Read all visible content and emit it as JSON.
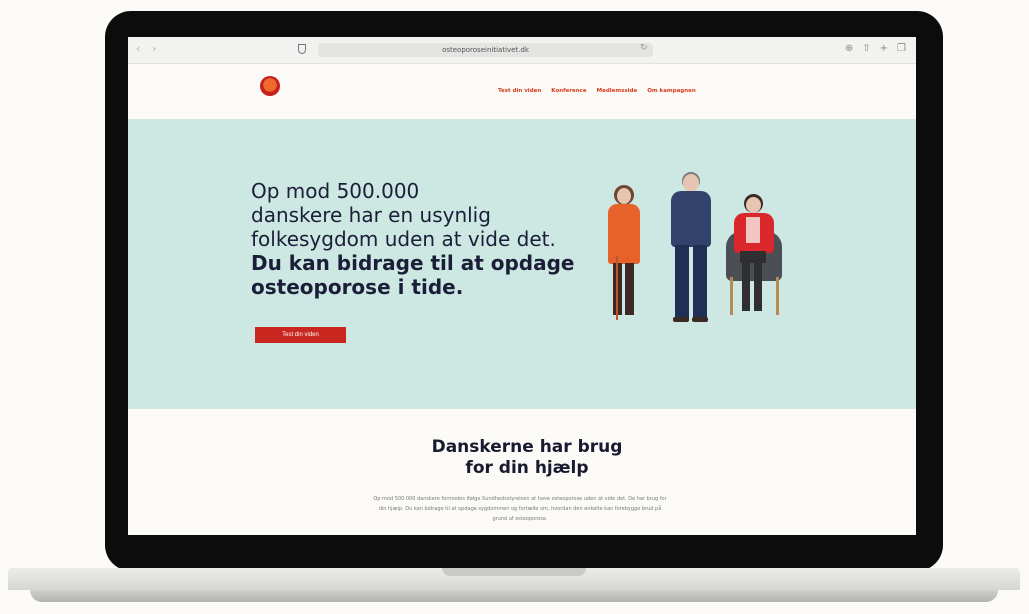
{
  "browser": {
    "url": "osteoporoseinitiativet.dk"
  },
  "site": {
    "nav": [
      "Test din viden",
      "Konference",
      "Medlemsside",
      "Om kampagnen"
    ]
  },
  "hero": {
    "line1": "Op mod 500.000",
    "line2": "danskere har en usynlig",
    "line3": "folkesygdom uden at vide det.",
    "strong1": "Du kan bidrage til at opdage",
    "strong2": "osteoporose i tide.",
    "button": "Test din viden"
  },
  "section": {
    "title1": "Danskerne har brug",
    "title2": "for din hjælp",
    "body": "Op mod 500.000 danskere formodes ifølge Sundhedsstyrelsen at have osteoporose uden at vide det. De har brug for din hjælp. Du kan bidrage til at opdage sygdommen og fortælle om, hvordan den enkelte kan forebygge brud på grund af osteoporose."
  },
  "colors": {
    "hero_bg": "#cde7e2",
    "accent": "#c8261e",
    "nav_link": "#d93a1c",
    "heading": "#1b1e38"
  }
}
